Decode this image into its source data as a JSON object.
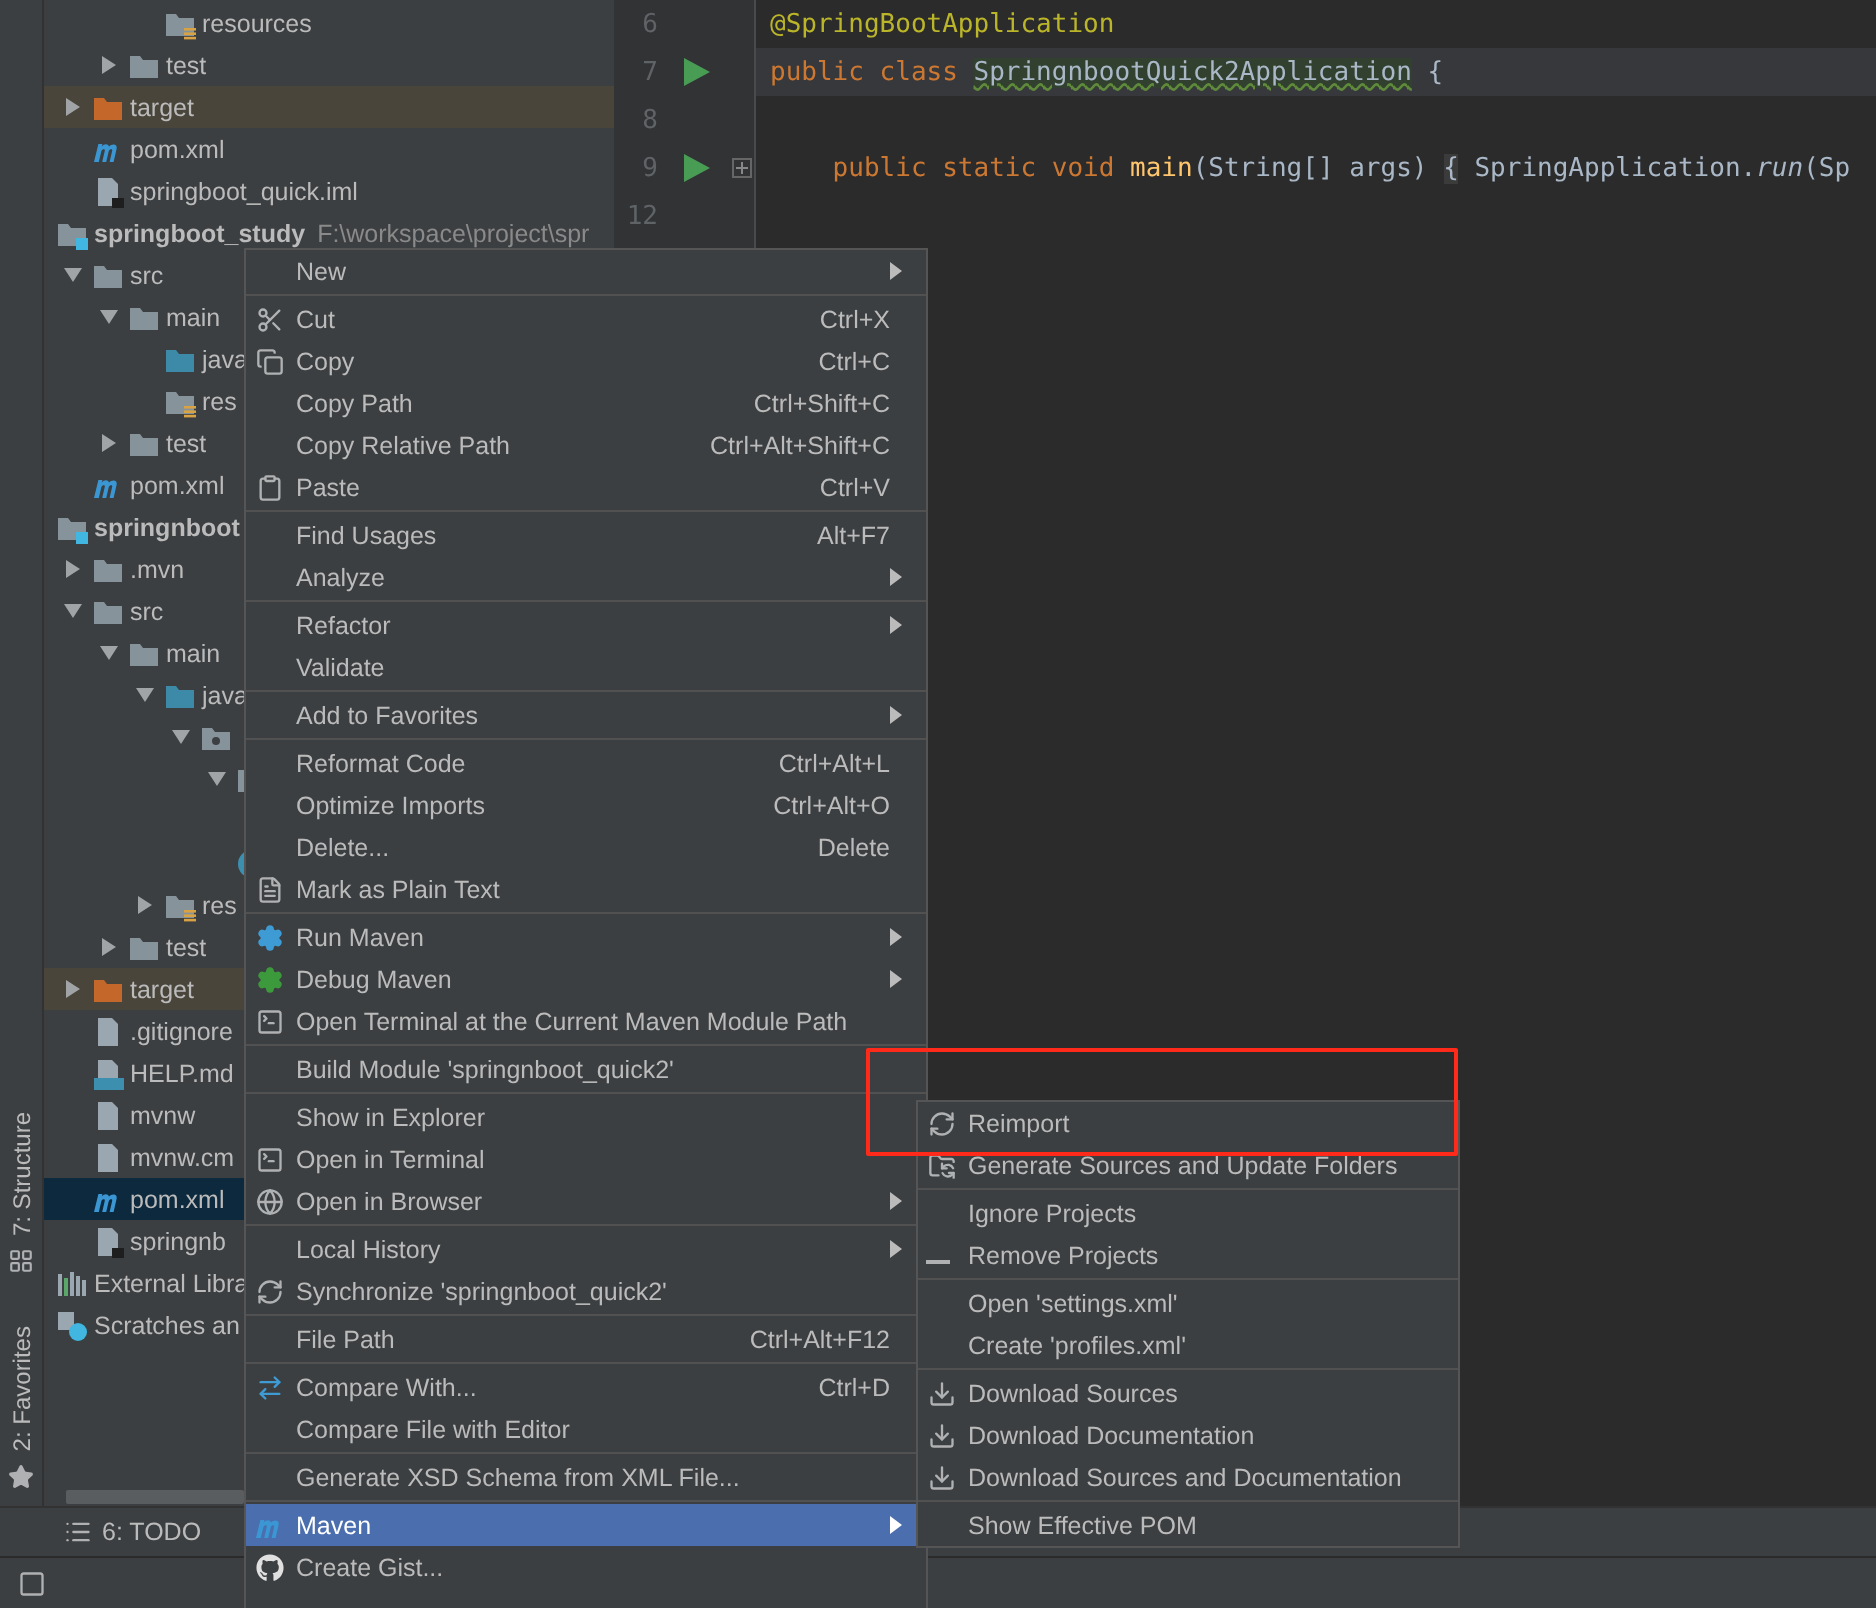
{
  "tool_strip": [
    {
      "label": "7: Structure",
      "kind": "structure"
    },
    {
      "label": "2: Favorites",
      "kind": "favorites"
    }
  ],
  "tree": [
    {
      "children": [
        {
          "children": [
            {
              "children": [
                {
                  "label": "resources",
                  "kind": "folder-resources",
                  "selected": false
                }
              ]
            },
            {
              "label": "test",
              "kind": "folder",
              "expanded": false,
              "selected": false
            }
          ]
        },
        {
          "label": "target",
          "kind": "folder-excluded",
          "expanded": false,
          "selected": false
        },
        {
          "label": "pom.xml",
          "kind": "maven",
          "selected": false
        },
        {
          "label": "springboot_quick.iml",
          "kind": "file-iml",
          "selected": false
        }
      ]
    },
    {
      "label": "springboot_study",
      "path": "F:\\workspace\\project\\spr",
      "kind": "module",
      "selected": false,
      "children": [
        {
          "label": "src",
          "kind": "folder",
          "expanded": true,
          "selected": false,
          "children": [
            {
              "label": "main",
              "kind": "folder",
              "expanded": true,
              "selected": false,
              "children": [
                {
                  "label": "java",
                  "kind": "folder-source",
                  "selected": false
                },
                {
                  "label": "res",
                  "kind": "folder-resources",
                  "selected": false
                }
              ]
            },
            {
              "label": "test",
              "kind": "folder",
              "expanded": false,
              "selected": false
            }
          ]
        },
        {
          "label": "pom.xml",
          "kind": "maven",
          "selected": false
        }
      ]
    },
    {
      "label": "springnboot",
      "kind": "module",
      "selected": false,
      "children": [
        {
          "label": ".mvn",
          "kind": "folder",
          "expanded": false,
          "selected": false
        },
        {
          "label": "src",
          "kind": "folder",
          "expanded": true,
          "selected": false,
          "children": [
            {
              "label": "main",
              "kind": "folder",
              "expanded": true,
              "selected": false,
              "children": [
                {
                  "label": "java",
                  "kind": "folder-source",
                  "expanded": true,
                  "selected": false,
                  "children": [
                    {
                      "kind": "folder-package",
                      "expanded": true,
                      "selected": false,
                      "children": [
                        {
                          "kind": "folder-package",
                          "expanded": true,
                          "selected": false,
                          "children": [
                            {
                              "kind": "hidden-item"
                            }
                          ]
                        },
                        {
                          "kind": "class",
                          "selected": false
                        }
                      ]
                    }
                  ]
                },
                {
                  "label": "res",
                  "kind": "folder-resources",
                  "expanded": false,
                  "selected": false
                }
              ]
            },
            {
              "label": "test",
              "kind": "folder",
              "expanded": false,
              "selected": false
            }
          ]
        },
        {
          "label": "target",
          "kind": "folder-excluded",
          "expanded": false,
          "selected": false
        },
        {
          "label": ".gitignore",
          "kind": "file",
          "selected": false
        },
        {
          "label": "HELP.md",
          "kind": "file-md",
          "selected": false
        },
        {
          "label": "mvnw",
          "kind": "file",
          "selected": false
        },
        {
          "label": "mvnw.cm",
          "kind": "file",
          "selected": false
        },
        {
          "label": "pom.xml",
          "kind": "maven",
          "selected": true
        },
        {
          "label": "springnb",
          "kind": "file-iml",
          "selected": false
        }
      ]
    },
    {
      "label": "External Libra",
      "kind": "libraries",
      "selected": false
    },
    {
      "label": "Scratches an",
      "kind": "scratches",
      "selected": false
    }
  ],
  "editor": {
    "lines": [
      {
        "number": "6",
        "run": false,
        "fold": false,
        "current": false,
        "tokens": [
          {
            "kind": "annotation",
            "text": "@SpringBootApplication"
          }
        ]
      },
      {
        "number": "7",
        "run": true,
        "fold": false,
        "current": true,
        "tokens": [
          {
            "kind": "keyword",
            "text": "public class "
          },
          {
            "kind": "class-name",
            "text": "SpringnbootQuick2Application"
          },
          {
            "kind": "plain",
            "text": " {"
          }
        ]
      },
      {
        "number": "8",
        "run": false,
        "fold": false,
        "current": false
      },
      {
        "number": "9",
        "run": true,
        "fold": true,
        "current": false,
        "tokens": [
          {
            "kind": "keyword",
            "text": "    public static void "
          },
          {
            "kind": "method",
            "text": "main"
          },
          {
            "kind": "plain",
            "text": "(String[] args) "
          },
          {
            "kind": "folded",
            "text": "{"
          },
          {
            "kind": "plain",
            "text": " SpringApplication."
          },
          {
            "kind": "static-call",
            "text": "run"
          },
          {
            "kind": "plain",
            "text": "(Sp"
          }
        ]
      },
      {
        "number": "12",
        "run": false,
        "fold": false,
        "current": false
      }
    ]
  },
  "bottom_bar": {
    "tabs": [
      {
        "label": "6: TODO",
        "kind": "list"
      }
    ]
  },
  "context_menu": {
    "groups": [
      [
        {
          "label": "New",
          "submenu": true,
          "selected": false
        }
      ],
      [
        {
          "label": "Cut",
          "shortcut": "Ctrl+X",
          "kind": "scissors",
          "submenu": false,
          "selected": false
        },
        {
          "label": "Copy",
          "shortcut": "Ctrl+C",
          "kind": "copy",
          "submenu": false,
          "selected": false
        },
        {
          "label": "Copy Path",
          "shortcut": "Ctrl+Shift+C",
          "submenu": false,
          "selected": false
        },
        {
          "label": "Copy Relative Path",
          "shortcut": "Ctrl+Alt+Shift+C",
          "submenu": false,
          "selected": false
        },
        {
          "label": "Paste",
          "shortcut": "Ctrl+V",
          "kind": "clipboard",
          "submenu": false,
          "selected": false
        }
      ],
      [
        {
          "label": "Find Usages",
          "shortcut": "Alt+F7",
          "submenu": false,
          "selected": false
        },
        {
          "label": "Analyze",
          "submenu": true,
          "selected": false
        }
      ],
      [
        {
          "label": "Refactor",
          "submenu": true,
          "selected": false
        },
        {
          "label": "Validate",
          "submenu": false,
          "selected": false
        }
      ],
      [
        {
          "label": "Add to Favorites",
          "submenu": true,
          "selected": false
        }
      ],
      [
        {
          "label": "Reformat Code",
          "shortcut": "Ctrl+Alt+L",
          "submenu": false,
          "selected": false
        },
        {
          "label": "Optimize Imports",
          "shortcut": "Ctrl+Alt+O",
          "submenu": false,
          "selected": false
        },
        {
          "label": "Delete...",
          "shortcut": "Delete",
          "submenu": false,
          "selected": false
        },
        {
          "label": "Mark as Plain Text",
          "kind": "plain-text",
          "submenu": false,
          "selected": false
        }
      ],
      [
        {
          "label": "Run Maven",
          "kind": "run-gear",
          "submenu": true,
          "selected": false
        },
        {
          "label": "Debug Maven",
          "kind": "debug-gear",
          "submenu": true,
          "selected": false
        },
        {
          "label": "Open Terminal at the Current Maven Module Path",
          "kind": "terminal",
          "submenu": false,
          "selected": false
        }
      ],
      [
        {
          "label": "Build Module 'springnboot_quick2'",
          "submenu": false,
          "selected": false
        }
      ],
      [
        {
          "label": "Show in Explorer",
          "submenu": false,
          "selected": false
        },
        {
          "label": "Open in Terminal",
          "kind": "terminal",
          "submenu": false,
          "selected": false
        },
        {
          "label": "Open in Browser",
          "kind": "globe",
          "submenu": true,
          "selected": false
        }
      ],
      [
        {
          "label": "Local History",
          "submenu": true,
          "selected": false
        },
        {
          "label": "Synchronize 'springnboot_quick2'",
          "kind": "sync",
          "submenu": false,
          "selected": false
        }
      ],
      [
        {
          "label": "File Path",
          "shortcut": "Ctrl+Alt+F12",
          "submenu": false,
          "selected": false
        }
      ],
      [
        {
          "label": "Compare With...",
          "shortcut": "Ctrl+D",
          "kind": "compare",
          "submenu": false,
          "selected": false
        },
        {
          "label": "Compare File with Editor",
          "submenu": false,
          "selected": false
        }
      ],
      [
        {
          "label": "Generate XSD Schema from XML File...",
          "submenu": false,
          "selected": false
        }
      ],
      [
        {
          "label": "Maven",
          "kind": "maven",
          "submenu": true,
          "selected": true
        },
        {
          "label": "Create Gist...",
          "kind": "github",
          "submenu": false,
          "selected": false
        }
      ]
    ]
  },
  "maven_submenu": {
    "groups": [
      [
        {
          "label": "Reimport",
          "kind": "sync",
          "submenu": false,
          "selected": false
        },
        {
          "label": "Generate Sources and Update Folders",
          "kind": "generate",
          "submenu": false,
          "selected": false
        }
      ],
      [
        {
          "label": "Ignore Projects",
          "submenu": false,
          "selected": false
        },
        {
          "label": "Remove Projects",
          "kind": "minus",
          "submenu": false,
          "selected": false
        }
      ],
      [
        {
          "label": "Open 'settings.xml'",
          "submenu": false,
          "selected": false
        },
        {
          "label": "Create 'profiles.xml'",
          "submenu": false,
          "selected": false
        }
      ],
      [
        {
          "label": "Download Sources",
          "kind": "download",
          "submenu": false,
          "selected": false
        },
        {
          "label": "Download Documentation",
          "kind": "download",
          "submenu": false,
          "selected": false
        },
        {
          "label": "Download Sources and Documentation",
          "kind": "download",
          "submenu": false,
          "selected": false
        }
      ],
      [
        {
          "label": "Show Effective POM",
          "submenu": false,
          "selected": false
        }
      ]
    ]
  }
}
